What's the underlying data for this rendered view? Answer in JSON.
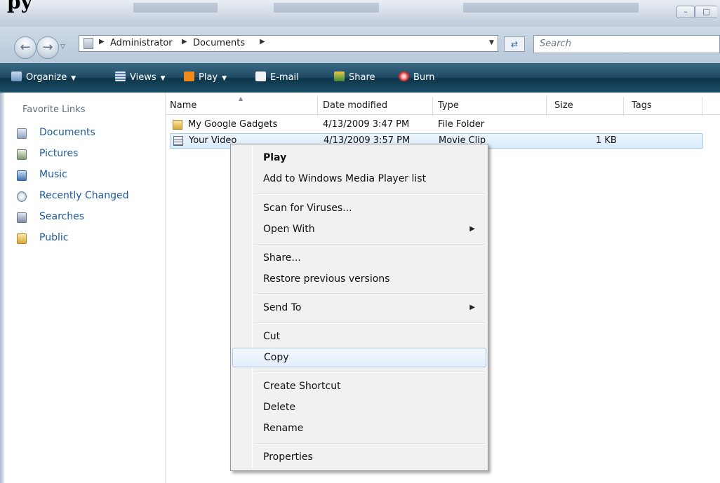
{
  "window": {
    "title_fragment": "py"
  },
  "address": {
    "crumbs": [
      "Administrator",
      "Documents"
    ],
    "search_placeholder": "Search"
  },
  "toolbar": {
    "organize": "Organize",
    "views": "Views",
    "play": "Play",
    "email": "E-mail",
    "share": "Share",
    "burn": "Burn"
  },
  "sidebar": {
    "title": "Favorite Links",
    "items": [
      {
        "label": "Documents",
        "icon": "documents-icon"
      },
      {
        "label": "Pictures",
        "icon": "pictures-icon"
      },
      {
        "label": "Music",
        "icon": "music-icon"
      },
      {
        "label": "Recently Changed",
        "icon": "recently-changed-icon"
      },
      {
        "label": "Searches",
        "icon": "searches-icon"
      },
      {
        "label": "Public",
        "icon": "folder-icon"
      }
    ]
  },
  "filelist": {
    "columns": [
      "Name",
      "Date modified",
      "Type",
      "Size",
      "Tags"
    ],
    "rows": [
      {
        "name": "My Google Gadgets",
        "date": "4/13/2009 3:47 PM",
        "type": "File Folder",
        "size": "",
        "icon": "folder-icon"
      },
      {
        "name": "Your Video",
        "date": "4/13/2009 3:57 PM",
        "type": "Movie Clip",
        "size": "1 KB",
        "icon": "video-file-icon"
      }
    ]
  },
  "context_menu": {
    "items": {
      "play": "Play",
      "add_wmp": "Add to Windows Media Player list",
      "scan": "Scan for Viruses...",
      "open_with": "Open With",
      "share": "Share...",
      "restore": "Restore previous versions",
      "send_to": "Send To",
      "cut": "Cut",
      "copy": "Copy",
      "create_shortcut": "Create Shortcut",
      "delete": "Delete",
      "rename": "Rename",
      "properties": "Properties"
    },
    "hovered": "Copy"
  },
  "colors": {
    "command_bar": "#1f4a63",
    "link_blue": "#1c5aa0",
    "selection": "#d8ebfa"
  }
}
